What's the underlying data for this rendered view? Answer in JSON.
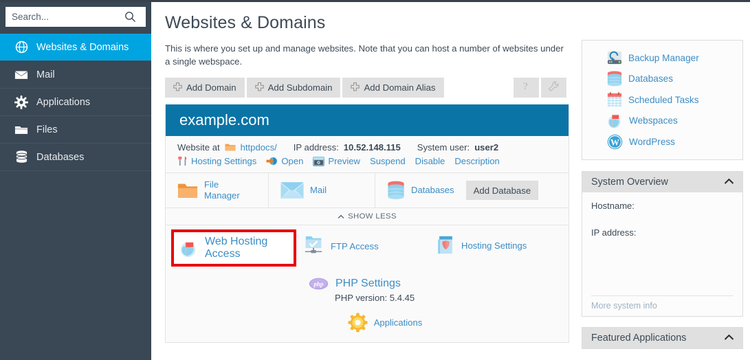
{
  "sidebar": {
    "search": {
      "placeholder": "Search...",
      "value": "",
      "icon": "search-icon"
    },
    "items": [
      {
        "label": "Websites & Domains",
        "icon": "globe-icon",
        "active": true
      },
      {
        "label": "Mail",
        "icon": "envelope-icon",
        "active": false
      },
      {
        "label": "Applications",
        "icon": "gear-icon",
        "active": false
      },
      {
        "label": "Files",
        "icon": "folder-icon",
        "active": false
      },
      {
        "label": "Databases",
        "icon": "database-icon",
        "active": false
      }
    ]
  },
  "main": {
    "title": "Websites & Domains",
    "description": "This is where you set up and manage websites. Note that you can host a number of websites under a single webspace.",
    "toolbar": {
      "add_domain": "Add Domain",
      "add_subdomain": "Add Subdomain",
      "add_domain_alias": "Add Domain Alias",
      "help_icon": "question-mark-icon",
      "tools_icon": "wrench-icon"
    },
    "card": {
      "domain": "example.com",
      "info": {
        "website_at_label": "Website at",
        "website_at_path": "httpdocs/",
        "ip_label": "IP address:",
        "ip_value": "10.52.148.115",
        "user_label": "System user:",
        "user_value": "user2"
      },
      "actions": [
        {
          "label": "Hosting Settings",
          "icon": "tools-fork-knife-icon"
        },
        {
          "label": "Open",
          "icon": "open-arrow-icon"
        },
        {
          "label": "Preview",
          "icon": "preview-icon"
        },
        {
          "label": "Suspend",
          "icon": ""
        },
        {
          "label": "Disable",
          "icon": ""
        },
        {
          "label": "Description",
          "icon": ""
        }
      ],
      "tiles": [
        {
          "label": "File\nManager",
          "label_l1": "File",
          "label_l2": "Manager",
          "icon": "orange-folder-icon"
        },
        {
          "label": "Mail",
          "icon": "blue-envelope-icon"
        },
        {
          "label": "Databases",
          "icon": "database-stack-icon"
        }
      ],
      "add_database_button": "Add Database",
      "show_less": "SHOW LESS",
      "show_less_icon": "chevron-up-icon",
      "grid": [
        {
          "label": "Web Hosting Access",
          "icon": "globe-flag-icon",
          "highlighted": true
        },
        {
          "label": "FTP Access",
          "icon": "ftp-folder-check-icon",
          "highlighted": false
        },
        {
          "label": "Hosting Settings",
          "icon": "shield-panel-icon",
          "highlighted": false
        }
      ],
      "php": {
        "label": "PHP Settings",
        "icon": "php-icon",
        "version_text": "PHP version: 5.4.45"
      },
      "applications": {
        "label": "Applications",
        "icon": "yellow-gear-icon"
      }
    }
  },
  "right": {
    "quick_links": [
      {
        "label": "Backup Manager",
        "icon": "backup-drive-icon"
      },
      {
        "label": "Databases",
        "icon": "database-stack-icon"
      },
      {
        "label": "Scheduled Tasks",
        "icon": "calendar-icon"
      },
      {
        "label": "Webspaces",
        "icon": "globe-flag-icon"
      },
      {
        "label": "WordPress",
        "icon": "wordpress-icon"
      }
    ],
    "system_overview": {
      "title": "System Overview",
      "collapse_icon": "chevron-up-icon",
      "hostname_label": "Hostname:",
      "ip_label": "IP address:",
      "more_link": "More system info"
    },
    "featured_applications": {
      "title": "Featured Applications",
      "collapse_icon": "chevron-up-icon"
    }
  },
  "colors": {
    "sidebar_bg": "#3a4754",
    "sidebar_active": "#00a4e0",
    "card_header": "#0a74a6",
    "link": "#3c8dc5",
    "highlight_red": "#e8000b",
    "button_gray": "#e0e0e0"
  }
}
